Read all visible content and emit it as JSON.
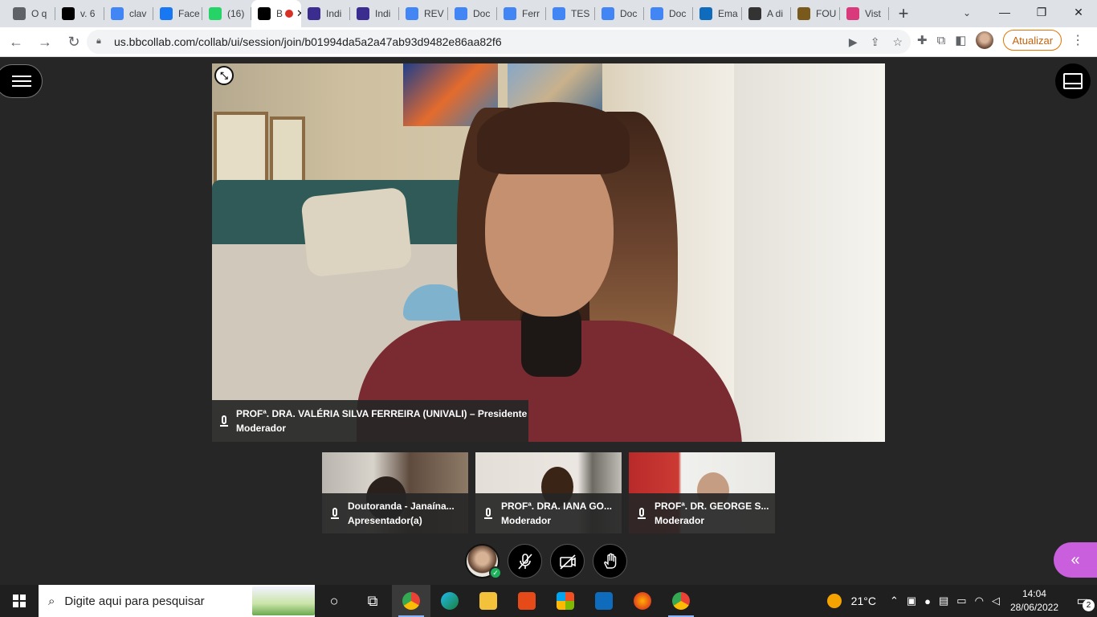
{
  "browser": {
    "tabs": [
      {
        "label": "O q",
        "icon": "chrome-icon",
        "color": "#5f6368"
      },
      {
        "label": "v. 6",
        "icon": "pkp-icon",
        "color": "#000000"
      },
      {
        "label": "clav",
        "icon": "google-icon",
        "color": "#4285f4"
      },
      {
        "label": "Face",
        "icon": "facebook-icon",
        "color": "#1877f2"
      },
      {
        "label": "(16)",
        "icon": "whatsapp-icon",
        "color": "#25d366"
      },
      {
        "label": "B",
        "icon": "blackboard-icon",
        "color": "#000000",
        "active": true
      },
      {
        "label": "Indi",
        "icon": "document-icon",
        "color": "#3b2d8f"
      },
      {
        "label": "Indi",
        "icon": "document-icon",
        "color": "#3b2d8f"
      },
      {
        "label": "REV",
        "icon": "google-docs-icon",
        "color": "#4285f4"
      },
      {
        "label": "Doc",
        "icon": "google-docs-icon",
        "color": "#4285f4"
      },
      {
        "label": "Ferr",
        "icon": "google-docs-icon",
        "color": "#4285f4"
      },
      {
        "label": "TES",
        "icon": "google-docs-icon",
        "color": "#4285f4"
      },
      {
        "label": "Doc",
        "icon": "google-docs-icon",
        "color": "#4285f4"
      },
      {
        "label": "Doc",
        "icon": "google-docs-icon",
        "color": "#4285f4"
      },
      {
        "label": "Ema",
        "icon": "outlook-icon",
        "color": "#0f6cbd"
      },
      {
        "label": "A di",
        "icon": "library-icon",
        "color": "#333333"
      },
      {
        "label": "FOU",
        "icon": "crest-icon",
        "color": "#7a5a1c"
      },
      {
        "label": "Vist",
        "icon": "vista-icon",
        "color": "#d93a7c"
      }
    ],
    "new_tab": "+",
    "url": "us.bbcollab.com/collab/ui/session/join/b01994da5a2a47ab93d9482e86aa82f6",
    "update_label": "Atualizar"
  },
  "collab": {
    "presenter": {
      "name": "PROFª. DRA. VALÉRIA SILVA FERREIRA (UNIVALI) – Presidente",
      "role": "Moderador"
    },
    "participants": [
      {
        "name": "Doutoranda - Janaína...",
        "role": "Apresentador(a)"
      },
      {
        "name": "PROFª. DRA. IANA GO...",
        "role": "Moderador"
      },
      {
        "name": "PROFª. DR. GEORGE S...",
        "role": "Moderador"
      }
    ],
    "status_check": "✓"
  },
  "taskbar": {
    "search_placeholder": "Digite aqui para pesquisar",
    "temperature": "21°C",
    "time": "14:04",
    "date": "28/06/2022",
    "notifications": "2"
  }
}
